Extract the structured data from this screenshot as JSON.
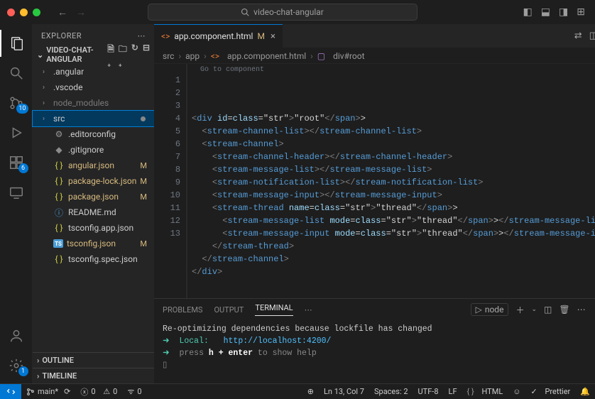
{
  "title": {
    "projectName": "video-chat-angular"
  },
  "activity": {
    "scmBadge": "10",
    "extBadge": "6",
    "settingsBadge": "1"
  },
  "sidebar": {
    "title": "EXPLORER",
    "project": "VIDEO-CHAT-ANGULAR",
    "tree": [
      {
        "label": ".angular",
        "type": "folder",
        "mod": ""
      },
      {
        "label": ".vscode",
        "type": "folder",
        "mod": ""
      },
      {
        "label": "node_modules",
        "type": "folder-dim",
        "mod": ""
      },
      {
        "label": "src",
        "type": "folder",
        "mod": "dot",
        "selected": true
      },
      {
        "label": ".editorconfig",
        "type": "config",
        "mod": ""
      },
      {
        "label": ".gitignore",
        "type": "gitignore",
        "mod": ""
      },
      {
        "label": "angular.json",
        "type": "json",
        "mod": "M"
      },
      {
        "label": "package-lock.json",
        "type": "json",
        "mod": "M"
      },
      {
        "label": "package.json",
        "type": "json",
        "mod": "M"
      },
      {
        "label": "README.md",
        "type": "readme",
        "mod": ""
      },
      {
        "label": "tsconfig.app.json",
        "type": "json",
        "mod": ""
      },
      {
        "label": "tsconfig.json",
        "type": "ts",
        "mod": "M"
      },
      {
        "label": "tsconfig.spec.json",
        "type": "json",
        "mod": ""
      }
    ],
    "outline": "OUTLINE",
    "timeline": "TIMELINE"
  },
  "editor": {
    "tabFile": "app.component.html",
    "tabMod": "M",
    "breadcrumb": {
      "p1": "src",
      "p2": "app",
      "p3": "app.component.html",
      "p4": "div#root"
    },
    "codelens": "Go to component",
    "lines": [
      "<div id=\"root\">",
      "  <stream-channel-list></stream-channel-list>",
      "  <stream-channel>",
      "    <stream-channel-header></stream-channel-header>",
      "    <stream-message-list></stream-message-list>",
      "    <stream-notification-list></stream-notification-list>",
      "    <stream-message-input></stream-message-input>",
      "    <stream-thread name=\"thread\">",
      "      <stream-message-list mode=\"thread\"></stream-message-list>",
      "      <stream-message-input mode=\"thread\"></stream-message-input>",
      "    </stream-thread>",
      "  </stream-channel>",
      "</div>"
    ]
  },
  "panel": {
    "tabs": {
      "problems": "PROBLEMS",
      "output": "OUTPUT",
      "terminal": "TERMINAL"
    },
    "node": "node",
    "term": {
      "l1": "Re-optimizing dependencies because lockfile has changed",
      "l2_label": "Local:",
      "l2_url": "http://localhost:4200/",
      "l3_a": "press ",
      "l3_b": "h + enter",
      "l3_c": " to show help"
    }
  },
  "status": {
    "branch": "main*",
    "sync": "",
    "errors": "0",
    "warnings": "0",
    "ports": "0",
    "lncol": "Ln 13, Col 7",
    "spaces": "Spaces: 2",
    "encoding": "UTF-8",
    "eol": "LF",
    "lang": "HTML",
    "prettier": "Prettier"
  }
}
